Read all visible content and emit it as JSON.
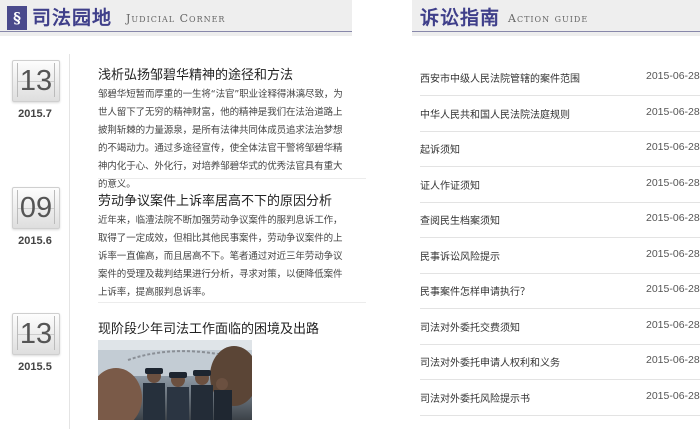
{
  "judicial_corner": {
    "logo_glyph": "§",
    "title": "司法园地",
    "subtitle": "Judicial Corner",
    "articles": [
      {
        "day": "13",
        "year_month": "2015.7",
        "title": "浅析弘扬邹碧华精神的途径和方法",
        "body": "邹碧华短暂而厚重的一生将“法官”职业诠释得淋漓尽致，为世人留下了无穷的精神财富，他的精神是我们在法治道路上披荆斩棘的力量源泉，是所有法律共同体成员追求法治梦想的不竭动力。通过多途径宣传，使全体法官干警将邹碧华精神内化于心、外化行，对培养邹碧华式的优秀法官具有重大的意义。"
      },
      {
        "day": "09",
        "year_month": "2015.6",
        "title": "劳动争议案件上诉率居高不下的原因分析",
        "body": "近年来，临澧法院不断加强劳动争议案件的服判息诉工作，取得了一定成效，但相比其他民事案件，劳动争议案件的上诉率一直偏高，而且居高不下。笔者通过对近三年劳动争议案件的受理及裁判结果进行分析，寻求对策，以便降低案件上诉率，提高服判息诉率。"
      },
      {
        "day": "13",
        "year_month": "2015.5",
        "title": "现阶段少年司法工作面临的困境及出路",
        "body": ""
      }
    ]
  },
  "litigation_guide": {
    "title": "诉讼指南",
    "subtitle": "Action guide",
    "items": [
      {
        "title": "西安市中级人民法院管辖的案件范围",
        "date": "2015-06-28"
      },
      {
        "title": "中华人民共和国人民法院法庭规则",
        "date": "2015-06-28"
      },
      {
        "title": "起诉须知",
        "date": "2015-06-28"
      },
      {
        "title": "证人作证须知",
        "date": "2015-06-28"
      },
      {
        "title": "查阅民生档案须知",
        "date": "2015-06-28"
      },
      {
        "title": "民事诉讼风险提示",
        "date": "2015-06-28"
      },
      {
        "title": "民事案件怎样申请执行？",
        "date": "2015-06-28"
      },
      {
        "title": "司法对外委托交费须知",
        "date": "2015-06-28"
      },
      {
        "title": "司法对外委托申请人权利和义务",
        "date": "2015-06-28"
      },
      {
        "title": "司法对外委托风险提示书",
        "date": "2015-06-28"
      }
    ]
  },
  "colors": {
    "accent": "#3f3f8a",
    "header_bg": "#eeeeee"
  }
}
